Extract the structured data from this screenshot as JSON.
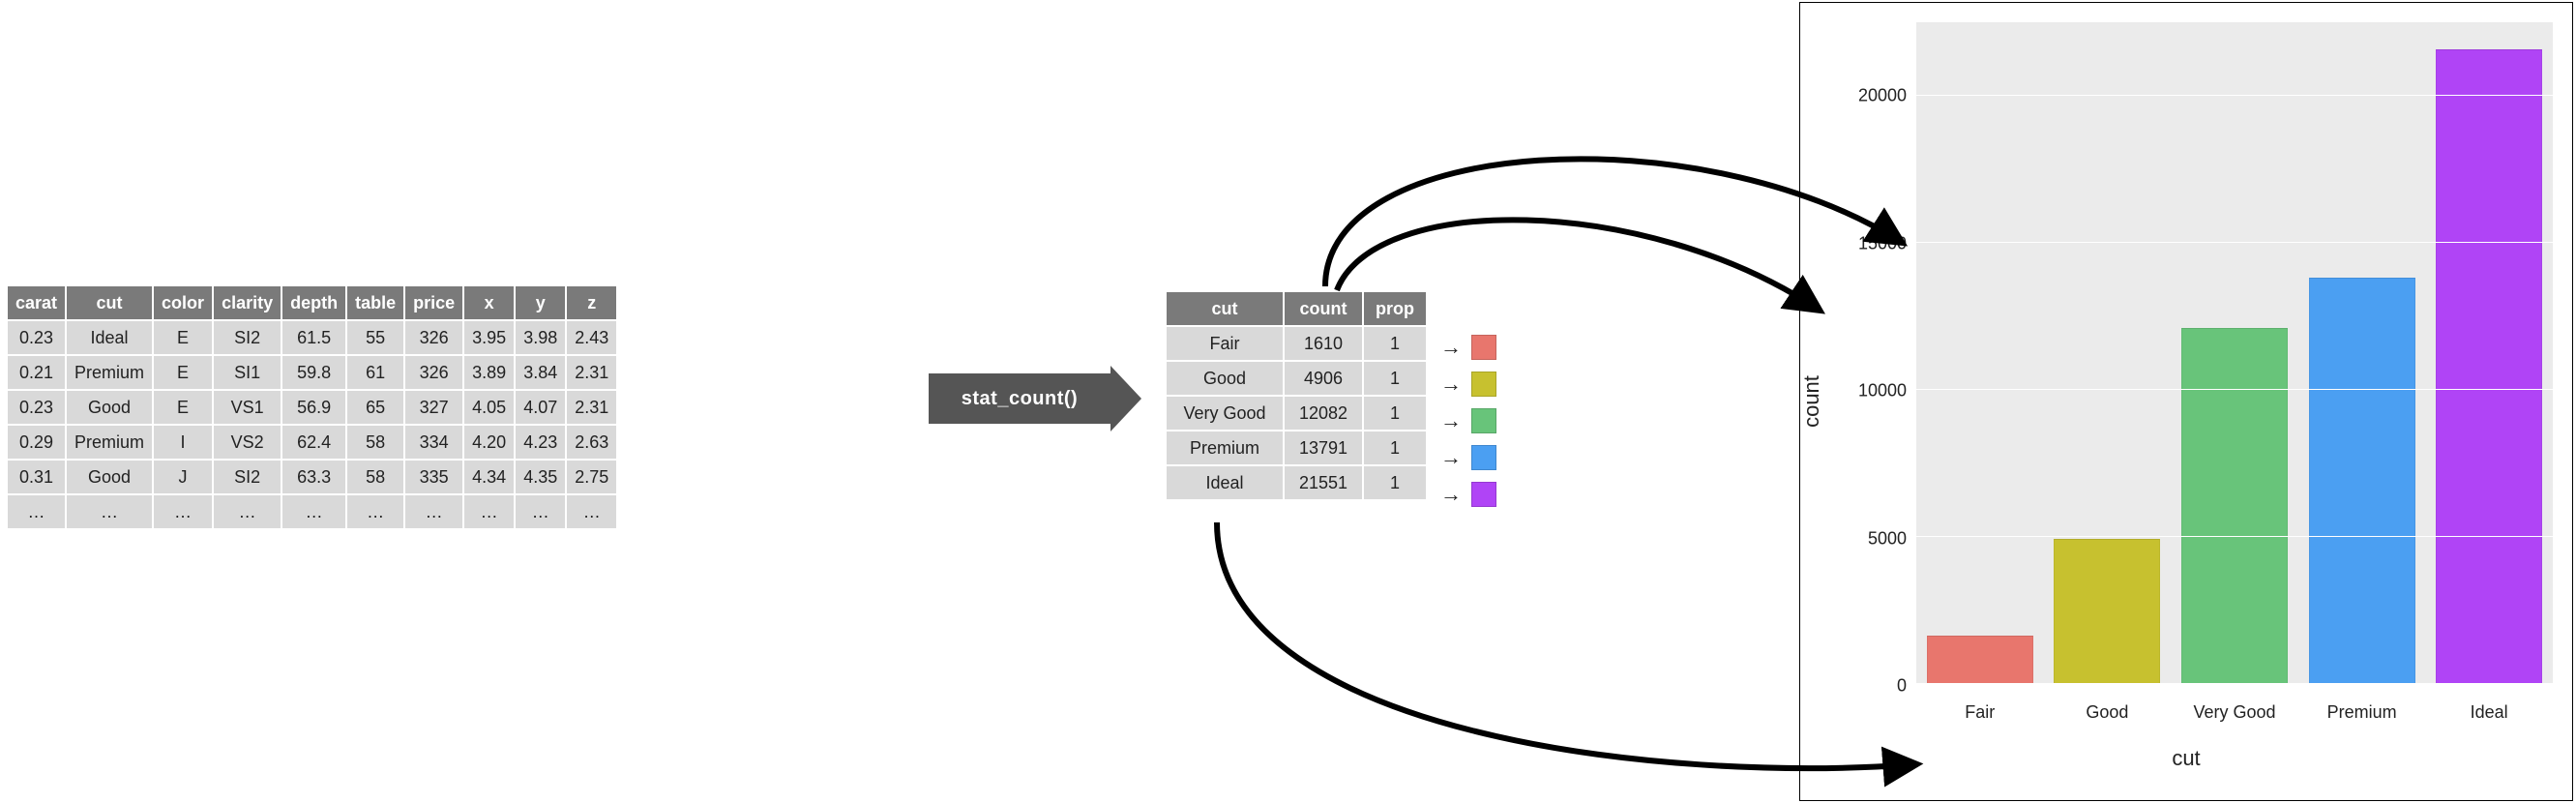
{
  "raw_table": {
    "headers": [
      "carat",
      "cut",
      "color",
      "clarity",
      "depth",
      "table",
      "price",
      "x",
      "y",
      "z"
    ],
    "rows": [
      [
        "0.23",
        "Ideal",
        "E",
        "SI2",
        "61.5",
        "55",
        "326",
        "3.95",
        "3.98",
        "2.43"
      ],
      [
        "0.21",
        "Premium",
        "E",
        "SI1",
        "59.8",
        "61",
        "326",
        "3.89",
        "3.84",
        "2.31"
      ],
      [
        "0.23",
        "Good",
        "E",
        "VS1",
        "56.9",
        "65",
        "327",
        "4.05",
        "4.07",
        "2.31"
      ],
      [
        "0.29",
        "Premium",
        "I",
        "VS2",
        "62.4",
        "58",
        "334",
        "4.20",
        "4.23",
        "2.63"
      ],
      [
        "0.31",
        "Good",
        "J",
        "SI2",
        "63.3",
        "58",
        "335",
        "4.34",
        "4.35",
        "2.75"
      ],
      [
        "…",
        "…",
        "…",
        "…",
        "…",
        "…",
        "…",
        "…",
        "…",
        "…"
      ]
    ]
  },
  "transform_label": "stat_count()",
  "summary_table": {
    "headers": [
      "cut",
      "count",
      "prop"
    ],
    "rows": [
      {
        "cut": "Fair",
        "count": "1610",
        "prop": "1",
        "color": "#e8766d"
      },
      {
        "cut": "Good",
        "count": "4906",
        "prop": "1",
        "color": "#c7c12f"
      },
      {
        "cut": "Very Good",
        "count": "12082",
        "prop": "1",
        "color": "#68c47a"
      },
      {
        "cut": "Premium",
        "count": "13791",
        "prop": "1",
        "color": "#4b9ff2"
      },
      {
        "cut": "Ideal",
        "count": "21551",
        "prop": "1",
        "color": "#b044f6"
      }
    ]
  },
  "chart_data": {
    "type": "bar",
    "categories": [
      "Fair",
      "Good",
      "Very Good",
      "Premium",
      "Ideal"
    ],
    "values": [
      1610,
      4906,
      12082,
      13791,
      21551
    ],
    "colors": [
      "#e8766d",
      "#c7c12f",
      "#68c47a",
      "#4b9ff2",
      "#b044f6"
    ],
    "xlabel": "cut",
    "ylabel": "count",
    "y_ticks": [
      0,
      5000,
      10000,
      15000,
      20000
    ],
    "ylim": [
      0,
      22500
    ]
  }
}
